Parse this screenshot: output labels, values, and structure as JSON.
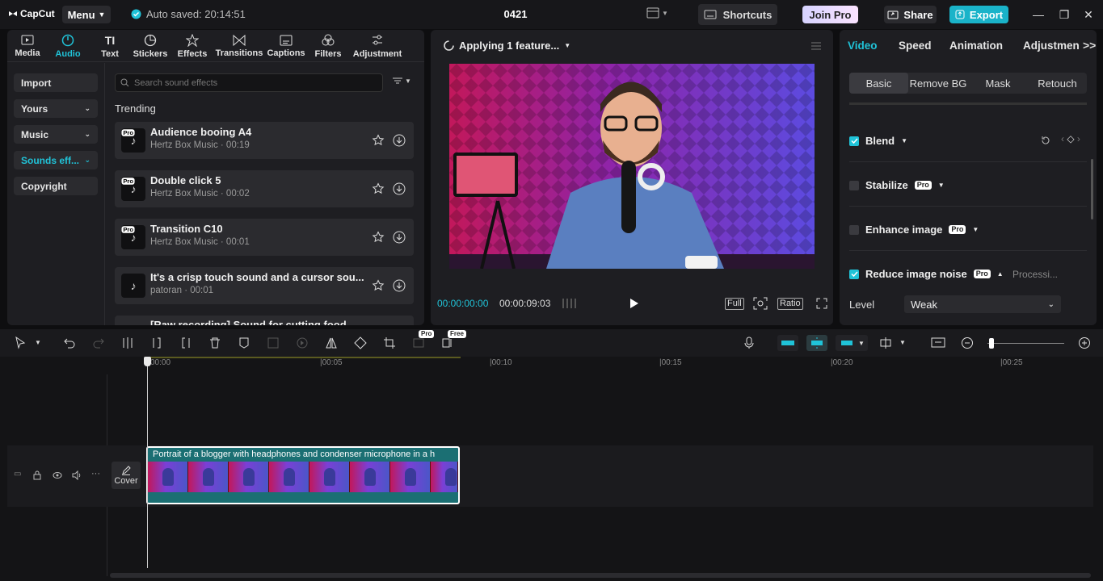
{
  "app": {
    "logo": "CapCut",
    "menu_label": "Menu",
    "autosave": "Auto saved: 20:14:51",
    "project_title": "0421",
    "shortcuts_label": "Shortcuts",
    "join_pro_label": "Join Pro",
    "share_label": "Share",
    "export_label": "Export"
  },
  "left_tabs": [
    {
      "label": "Media",
      "icon": "media-icon"
    },
    {
      "label": "Audio",
      "icon": "audio-icon"
    },
    {
      "label": "Text",
      "icon": "text-icon"
    },
    {
      "label": "Stickers",
      "icon": "stickers-icon"
    },
    {
      "label": "Effects",
      "icon": "effects-icon"
    },
    {
      "label": "Transitions",
      "icon": "transitions-icon"
    },
    {
      "label": "Captions",
      "icon": "captions-icon"
    },
    {
      "label": "Filters",
      "icon": "filters-icon"
    },
    {
      "label": "Adjustment",
      "icon": "adjustment-icon"
    }
  ],
  "sidebar": {
    "items": [
      {
        "label": "Import"
      },
      {
        "label": "Yours"
      },
      {
        "label": "Music"
      },
      {
        "label": "Sounds eff..."
      },
      {
        "label": "Copyright"
      }
    ]
  },
  "audio": {
    "search_placeholder": "Search sound effects",
    "section_title": "Trending",
    "pro_badge": "Pro",
    "items": [
      {
        "name": "Audience booing A4",
        "meta": "Hertz Box Music · 00:19"
      },
      {
        "name": "Double click 5",
        "meta": "Hertz Box Music · 00:02"
      },
      {
        "name": "Transition C10",
        "meta": "Hertz Box Music · 00:01"
      },
      {
        "name": "It's a crisp touch sound and a cursor sou...",
        "meta": "patoran · 00:01"
      },
      {
        "name": "[Raw recording] Sound for cutting food",
        "meta": ""
      }
    ]
  },
  "player": {
    "status": "Applying 1 feature...",
    "current_time": "00:00:00:00",
    "total_time": "00:00:09:03",
    "full_label": "Full",
    "ratio_label": "Ratio"
  },
  "inspector": {
    "tabs": [
      "Video",
      "Speed",
      "Animation",
      "Adjustmen"
    ],
    "subtabs": [
      "Basic",
      "Remove BG",
      "Mask",
      "Retouch"
    ],
    "options": [
      {
        "label": "Blend",
        "checked": true
      },
      {
        "label": "Stabilize",
        "checked": false,
        "pro": "Pro"
      },
      {
        "label": "Enhance image",
        "checked": false,
        "pro": "Pro"
      },
      {
        "label": "Reduce image noise",
        "checked": true,
        "pro": "Pro",
        "status": "Processi..."
      }
    ],
    "level_label": "Level",
    "level_value": "Weak"
  },
  "toolbar": {
    "pro_badge": "Pro",
    "free_badge": "Free"
  },
  "timeline": {
    "ticks": [
      "00:00",
      "|00:05",
      "|00:10",
      "|00:15",
      "|00:20",
      "|00:25"
    ],
    "clip_label": "Portrait of a blogger with headphones and condenser microphone in a h",
    "cover_label": "Cover"
  },
  "colors": {
    "accent": "#20c3d8",
    "export": "#1ab3c9",
    "clip": "#1b6f73"
  }
}
